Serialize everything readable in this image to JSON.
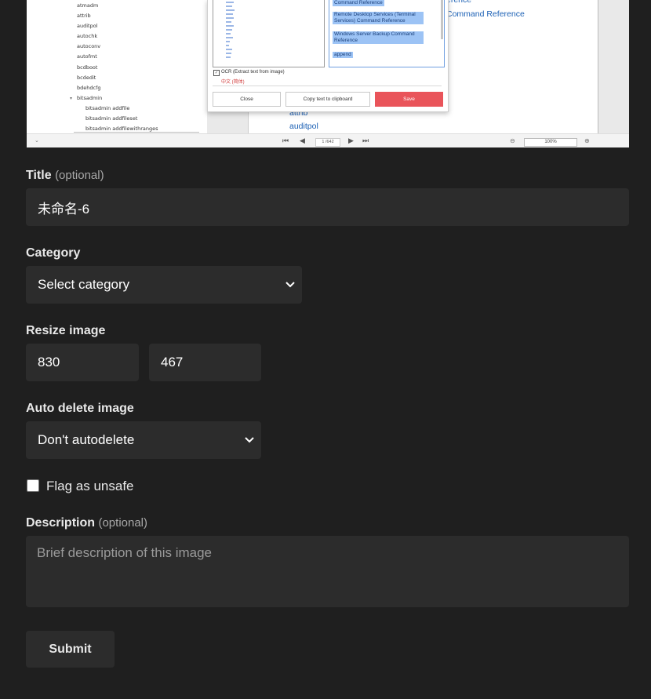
{
  "preview": {
    "tree_items": [
      "atmadm",
      "attrib",
      "auditpol",
      "autochk",
      "autoconv",
      "autofmt",
      "bcdboot",
      "bcdedit",
      "bdehdcfg",
      "bitsadmin",
      "bitsadmin addfile",
      "bitsadmin addfileset",
      "bitsadmin addfilewithranges"
    ],
    "dialog": {
      "selected_lines": [
        "Command Reference",
        "Remote Desktop Services (Terminal Services) Command Reference",
        "Windows Server Backup Command Reference",
        "append"
      ],
      "ocr_label": "OCR (Extract text from image)",
      "ocr_language": "中文 (简体)",
      "close_label": "Close",
      "copy_label": "Copy text to clipboard",
      "save_label": "Save"
    },
    "doc_links": [
      "erence",
      "Command Reference",
      "attrib",
      "auditpol"
    ],
    "page_indicator": "1 /642",
    "zoom": "100%"
  },
  "form": {
    "title_label": "Title",
    "title_optional": "(optional)",
    "title_value": "未命名-6",
    "category_label": "Category",
    "category_value": "Select category",
    "resize_label": "Resize image",
    "resize_width": "830",
    "resize_height": "467",
    "autodelete_label": "Auto delete image",
    "autodelete_value": "Don't autodelete",
    "flag_label": "Flag as unsafe",
    "description_label": "Description",
    "description_optional": "(optional)",
    "description_placeholder": "Brief description of this image",
    "submit_label": "Submit"
  },
  "colors": {
    "background": "#1f1f1f",
    "field": "#2c2c2c",
    "save_button": "#e9545a",
    "link": "#1a5fb4"
  }
}
